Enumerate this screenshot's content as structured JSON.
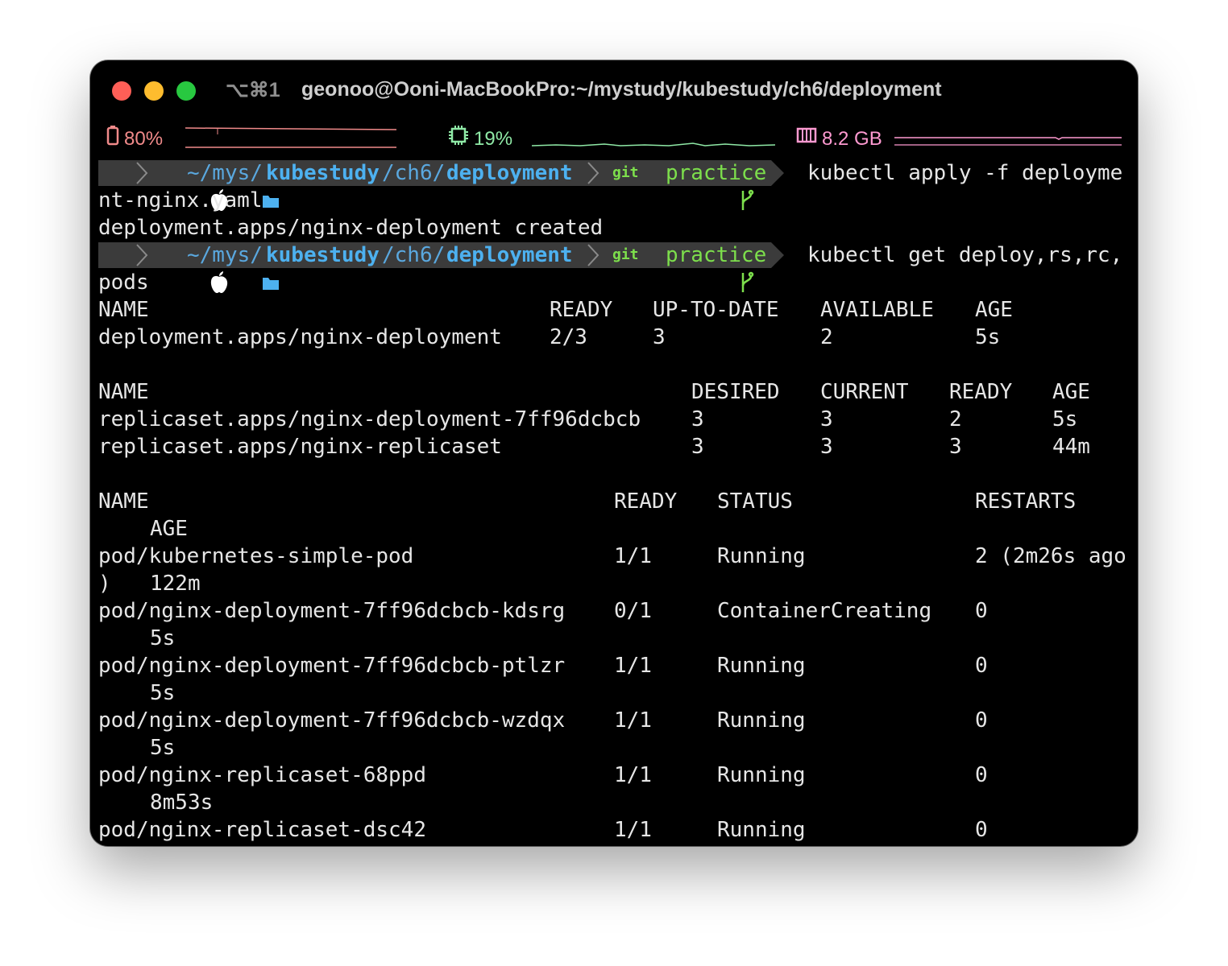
{
  "window": {
    "shortcut": "⌥⌘1",
    "title": "geonoo@Ooni-MacBookPro:~/mystudy/kubestudy/ch6/deployment"
  },
  "status_bar": {
    "battery": {
      "icon": "battery-icon",
      "value": "80%",
      "color": "#f08a8a"
    },
    "cpu": {
      "icon": "cpu-icon",
      "value": "19%",
      "color": "#8fe9a6"
    },
    "memory": {
      "icon": "memory-icon",
      "value": "8.2 GB",
      "color": "#ff9ad1"
    }
  },
  "prompt": {
    "path_home": "~/mys/",
    "path_repo": "kubestudy",
    "path_mid": "/ch6/",
    "path_leaf": "deployment",
    "git_label": "git",
    "branch": "practice"
  },
  "commands": {
    "first": "kubectl apply -f deployme",
    "first_wrap": "nt-nginx.yaml",
    "first_output": "deployment.apps/nginx-deployment created",
    "second": "kubectl get deploy,rs,rc,",
    "second_wrap": "pods"
  },
  "deployments": {
    "headers": [
      "NAME",
      "READY",
      "UP-TO-DATE",
      "AVAILABLE",
      "AGE"
    ],
    "rows": [
      [
        "deployment.apps/nginx-deployment",
        "2/3",
        "3",
        "2",
        "5s"
      ]
    ]
  },
  "replicasets": {
    "headers": [
      "NAME",
      "DESIRED",
      "CURRENT",
      "READY",
      "AGE"
    ],
    "rows": [
      [
        "replicaset.apps/nginx-deployment-7ff96dcbcb",
        "3",
        "3",
        "2",
        "5s"
      ],
      [
        "replicaset.apps/nginx-replicaset",
        "3",
        "3",
        "3",
        "44m"
      ]
    ]
  },
  "pods": {
    "headers": [
      "NAME",
      "READY",
      "STATUS",
      "RESTARTS",
      "AGE"
    ],
    "rows": [
      {
        "name": "pod/kubernetes-simple-pod",
        "ready": "1/1",
        "status": "Running",
        "restarts": "2 (2m26s ago",
        "wrap_prefix": ")",
        "age": "122m"
      },
      {
        "name": "pod/nginx-deployment-7ff96dcbcb-kdsrg",
        "ready": "0/1",
        "status": "ContainerCreating",
        "restarts": "0",
        "wrap_prefix": "",
        "age": "5s"
      },
      {
        "name": "pod/nginx-deployment-7ff96dcbcb-ptlzr",
        "ready": "1/1",
        "status": "Running",
        "restarts": "0",
        "wrap_prefix": "",
        "age": "5s"
      },
      {
        "name": "pod/nginx-deployment-7ff96dcbcb-wzdqx",
        "ready": "1/1",
        "status": "Running",
        "restarts": "0",
        "wrap_prefix": "",
        "age": "5s"
      },
      {
        "name": "pod/nginx-replicaset-68ppd",
        "ready": "1/1",
        "status": "Running",
        "restarts": "0",
        "wrap_prefix": "",
        "age": "8m53s"
      },
      {
        "name": "pod/nginx-replicaset-dsc42",
        "ready": "1/1",
        "status": "Running",
        "restarts": "0",
        "wrap_prefix": "",
        "age": ""
      }
    ]
  }
}
